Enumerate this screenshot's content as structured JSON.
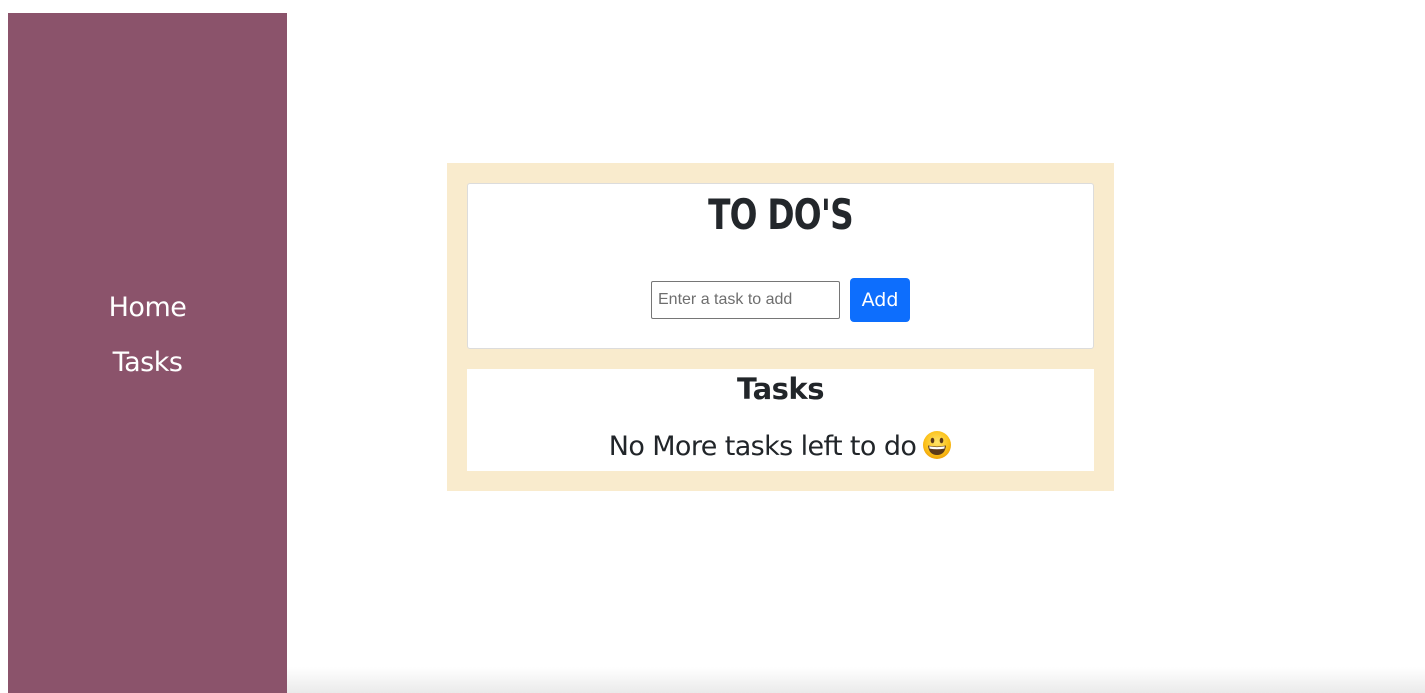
{
  "sidebar": {
    "items": [
      {
        "label": "Home"
      },
      {
        "label": "Tasks"
      }
    ]
  },
  "todo": {
    "title": "TO DO'S",
    "input_placeholder": "Enter a task to add",
    "input_value": "",
    "add_label": "Add"
  },
  "tasks": {
    "heading": "Tasks",
    "empty_message": "No More tasks left to do",
    "empty_icon": "grinning-face-icon"
  },
  "colors": {
    "sidebar_bg": "#8b536b",
    "panel_bg": "#f9ebcd",
    "button_bg": "#0d6efd",
    "text": "#212529"
  }
}
